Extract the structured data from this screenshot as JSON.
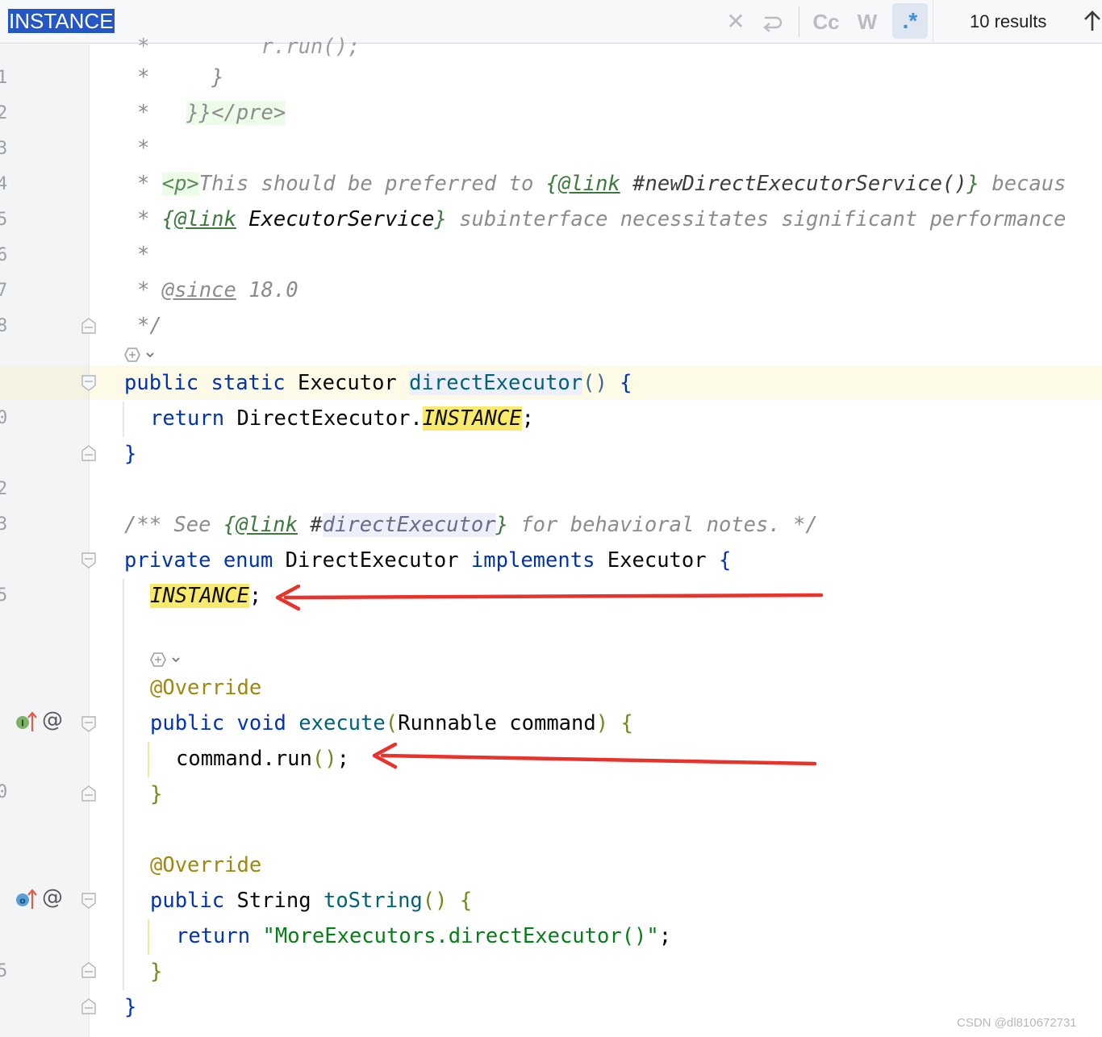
{
  "search": {
    "query": "INSTANCE",
    "results_text": "10 results",
    "toolbar_icons": [
      "close-icon",
      "newline-icon",
      "match-case-icon",
      "whole-words-icon",
      "regex-icon",
      "previous-occurrence-icon"
    ],
    "match_case_label": "Cc",
    "whole_words_label": "W",
    "regex_label": ".*"
  },
  "code": {
    "top_partial": "*         r.run();",
    "l1": [
      "*",
      "}"
    ],
    "l2": [
      "*",
      "}}</pre>"
    ],
    "l3": "*",
    "l4": [
      "*",
      "<p>",
      "This should be preferred to ",
      "{",
      "@link",
      " #newDirectExecutorService()",
      "}",
      " becaus"
    ],
    "l5": [
      "*",
      "{",
      "@link",
      " ExecutorService",
      "}",
      " subinterface necessitates significant performance"
    ],
    "l6": "*",
    "l7": [
      "*",
      "@since",
      " 18.0"
    ],
    "l8": "*/",
    "l9": [
      "public",
      "static",
      "Executor",
      "directExecutor",
      "()",
      "{"
    ],
    "l10": [
      "return",
      "DirectExecutor.",
      "INSTANCE",
      ";"
    ],
    "l11": "}",
    "l12": [
      "/** See ",
      "{",
      "@link",
      " #",
      "directExecutor",
      "}",
      " for behavioral notes. */"
    ],
    "l13": [
      "private",
      "enum",
      "DirectExecutor",
      "implements",
      "Executor",
      "{"
    ],
    "l14": [
      "INSTANCE",
      ";"
    ],
    "l15": "@Override",
    "l16": [
      "public",
      "void",
      "execute",
      "(",
      "Runnable command",
      ")",
      "{"
    ],
    "l17": [
      "command.run",
      "()",
      ";"
    ],
    "l18": "}",
    "l19": "@Override",
    "l20": [
      "public",
      "String",
      "toString",
      "()",
      "{"
    ],
    "l21": [
      "return",
      "\"MoreExecutors.directExecutor()\"",
      ";"
    ],
    "l22": "}",
    "l23": "}"
  },
  "gutter": {
    "at_symbol": "@",
    "marker_i": "I",
    "marker_o": "o"
  },
  "colors": {
    "match_highlight": "#f9ea6d",
    "keyword": "#0033b3",
    "annotation": "#9e880d",
    "string": "#067d17",
    "arrow": "#e8322b"
  },
  "watermark": "CSDN @dl810672731"
}
